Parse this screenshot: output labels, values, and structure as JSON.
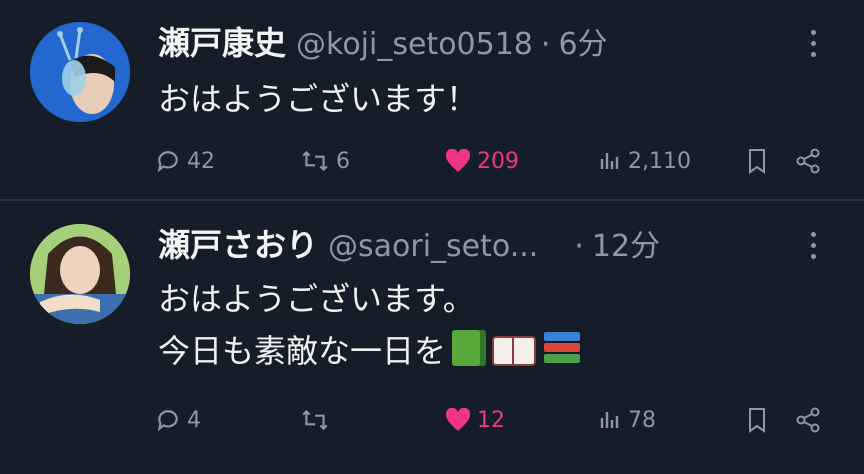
{
  "colors": {
    "background": "#151d28",
    "muted": "#8b98a5",
    "like": "#f1368a",
    "text": "#e7e9ea"
  },
  "tweets": [
    {
      "name": "瀬戸康史",
      "handle": "@koji_seto0518",
      "separator": "·",
      "time": "6分",
      "lines": [
        "おはようございます！"
      ],
      "replies": "42",
      "retweets": "6",
      "likes": "209",
      "liked": true,
      "views": "2,110"
    },
    {
      "name": "瀬戸さおり",
      "handle": "@saori_seto...",
      "separator": "·",
      "time": "12分",
      "lines": [
        "おはようございます。",
        "今日も素敵な一日を"
      ],
      "emoji": [
        "green-book",
        "open-book",
        "books"
      ],
      "replies": "4",
      "retweets": "",
      "likes": "12",
      "liked": true,
      "views": "78"
    }
  ]
}
